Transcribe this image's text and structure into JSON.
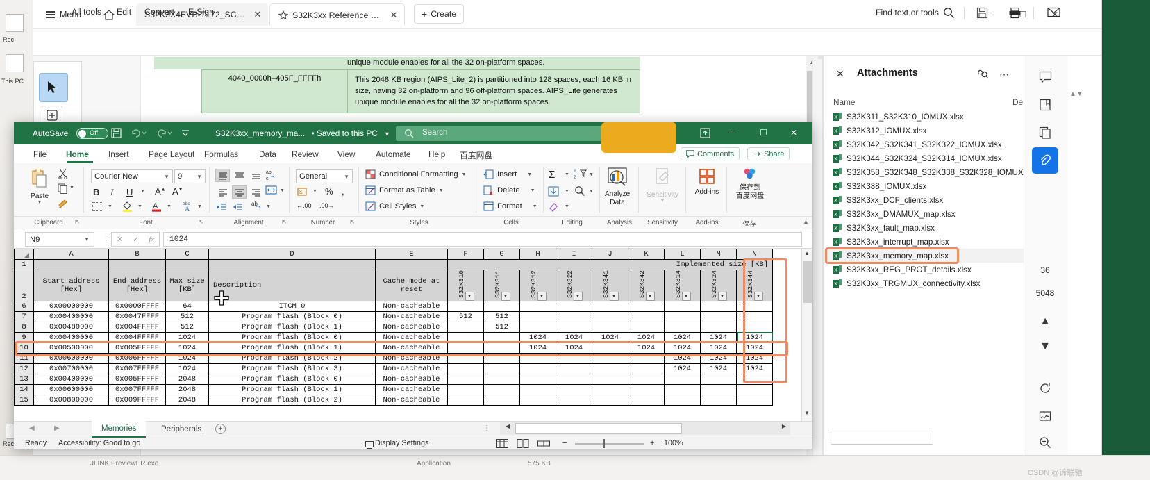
{
  "acrobat": {
    "menu_label": "Menu",
    "icons": {
      "hamburger": "hamburger-icon",
      "home": "home-icon",
      "star": "star-icon",
      "plus": "plus-icon"
    },
    "tabs": [
      {
        "title": "S32K3X4EVB-T172_SCH.pdf",
        "close": "✕"
      },
      {
        "title": "S32K3xx Reference Ma..",
        "close": "✕"
      }
    ],
    "create_label": "Create",
    "window_controls": {
      "minimize": "─",
      "maximize": "☐",
      "close": "✕"
    },
    "toolbar": {
      "all_tools": "All tools",
      "edit": "Edit",
      "convert": "Convert",
      "esign": "E-Sign",
      "find_label": "Find text or tools"
    },
    "page_text": {
      "top_line": "unique module enables for all the 32 on-platform spaces.",
      "range": "4040_0000h–405F_FFFFh",
      "body": "This 2048 KB region (AIPS_Lite_2) is partitioned into 128 spaces, each 16 KB in size, having 32 on-platform and 96 off-platform spaces. AIPS_Lite generates unique module enables for all the 32 on-platform spaces."
    },
    "attachments": {
      "title": "Attachments",
      "col_name": "Name",
      "col_desc": "De",
      "items": [
        "S32K311_S32K310_IOMUX.xlsx",
        "S32K312_IOMUX.xlsx",
        "S32K342_S32K341_S32K322_IOMUX.xlsx",
        "S32K344_S32K324_S32K314_IOMUX.xlsx",
        "S32K358_S32K348_S32K338_S32K328_IOMUX.xlsx",
        "S32K388_IOMUX.xlsx",
        "S32K3xx_DCF_clients.xlsx",
        "S32K3xx_DMAMUX_map.xlsx",
        "S32K3xx_fault_map.xlsx",
        "S32K3xx_interrupt_map.xlsx",
        "S32K3xx_memory_map.xlsx",
        "S32K3xx_REG_PROT_details.xlsx",
        "S32K3xx_TRGMUX_connectivity.xlsx"
      ],
      "selected_item": "S32K3xx_memory_map.xlsx"
    },
    "right_rail_values": {
      "page_count": "36",
      "total": "5048"
    }
  },
  "excel": {
    "autosave_label": "AutoSave",
    "autosave_state": "Off",
    "doc_name": "S32K3xx_memory_ma...",
    "save_state": "• Saved to this PC",
    "search_placeholder": "Search",
    "window_controls": {
      "ribbon_display": "⬆",
      "minimize": "─",
      "maximize": "☐",
      "close": "✕"
    },
    "ribbon_tabs": [
      "File",
      "Home",
      "Insert",
      "Page Layout",
      "Formulas",
      "Data",
      "Review",
      "View",
      "Automate",
      "Help",
      "百度网盘"
    ],
    "active_tab": "Home",
    "comments_label": "Comments",
    "share_label": "Share",
    "ribbon": {
      "paste_label": "Paste",
      "font_name": "Courier New",
      "font_size": "9",
      "number_format": "General",
      "styles": [
        "Conditional Formatting",
        "Format as Table",
        "Cell Styles"
      ],
      "cells": [
        "Insert",
        "Delete",
        "Format"
      ],
      "analyze_data": "Analyze Data",
      "sensitivity": "Sensitivity",
      "addins": "Add-ins",
      "baidu": "保存到\n百度网盘",
      "baidu_line1": "保存到",
      "baidu_line2": "百度网盘",
      "groups": [
        "Clipboard",
        "Font",
        "Alignment",
        "Number",
        "Styles",
        "Cells",
        "Editing",
        "Analysis",
        "Sensitivity",
        "Add-ins",
        "保存"
      ]
    },
    "formula_bar": {
      "name_box": "N9",
      "value": "1024",
      "fx_label": "fx",
      "cancel": "✕",
      "confirm": "✓"
    },
    "sheet": {
      "column_letters": [
        "A",
        "B",
        "C",
        "D",
        "E",
        "F",
        "G",
        "H",
        "I",
        "J",
        "K",
        "L",
        "M",
        "N"
      ],
      "banner": "Implemented size [KB]",
      "headers": [
        "Start address [Hex]",
        "End address [Hex]",
        "Max size [KB]",
        "Description",
        "Cache mode at reset"
      ],
      "header_lines": {
        "a": [
          "Start address",
          "[Hex]"
        ],
        "b": [
          "End address",
          "[Hex]"
        ],
        "c": [
          "Max size",
          "[KB]"
        ],
        "d": [
          "Description"
        ],
        "e": [
          "Cache mode at",
          "reset"
        ]
      },
      "device_columns": [
        "S32K310",
        "S32K311",
        "S32K312",
        "S32K322",
        "S32K341",
        "S32K342",
        "S32K314",
        "S32K324",
        "S32K344"
      ],
      "rows": [
        {
          "num": "6",
          "start": "0x00000000",
          "end": "0x0000FFFF",
          "max": "64",
          "desc": "ITCM_0",
          "cache": "Non-cacheable",
          "sizes": [
            "",
            "",
            "",
            "",
            "",
            "",
            "",
            "",
            ""
          ]
        },
        {
          "num": "7",
          "start": "0x00400000",
          "end": "0x0047FFFF",
          "max": "512",
          "desc": "Program flash (Block 0)",
          "cache": "Non-cacheable",
          "sizes": [
            "512",
            "512",
            "",
            "",
            "",
            "",
            "",
            "",
            ""
          ]
        },
        {
          "num": "8",
          "start": "0x00480000",
          "end": "0x004FFFFF",
          "max": "512",
          "desc": "Program flash (Block 1)",
          "cache": "Non-cacheable",
          "sizes": [
            "",
            "512",
            "",
            "",
            "",
            "",
            "",
            "",
            ""
          ]
        },
        {
          "num": "9",
          "start": "0x00400000",
          "end": "0x004FFFFF",
          "max": "1024",
          "desc": "Program flash (Block 0)",
          "cache": "Non-cacheable",
          "sizes": [
            "",
            "",
            "1024",
            "1024",
            "1024",
            "1024",
            "1024",
            "1024",
            "1024"
          ]
        },
        {
          "num": "10",
          "start": "0x00500000",
          "end": "0x005FFFFF",
          "max": "1024",
          "desc": "Program flash (Block 1)",
          "cache": "Non-cacheable",
          "sizes": [
            "",
            "",
            "1024",
            "1024",
            "",
            "1024",
            "1024",
            "1024",
            "1024"
          ]
        },
        {
          "num": "11",
          "start": "0x00600000",
          "end": "0x006FFFFF",
          "max": "1024",
          "desc": "Program flash (Block 2)",
          "cache": "Non-cacheable",
          "sizes": [
            "",
            "",
            "",
            "",
            "",
            "",
            "1024",
            "1024",
            "1024"
          ]
        },
        {
          "num": "12",
          "start": "0x00700000",
          "end": "0x007FFFFF",
          "max": "1024",
          "desc": "Program flash (Block 3)",
          "cache": "Non-cacheable",
          "sizes": [
            "",
            "",
            "",
            "",
            "",
            "",
            "1024",
            "1024",
            "1024"
          ]
        },
        {
          "num": "13",
          "start": "0x00400000",
          "end": "0x005FFFFF",
          "max": "2048",
          "desc": "Program flash (Block 0)",
          "cache": "Non-cacheable",
          "sizes": [
            "",
            "",
            "",
            "",
            "",
            "",
            "",
            "",
            ""
          ]
        },
        {
          "num": "14",
          "start": "0x00600000",
          "end": "0x007FFFFF",
          "max": "2048",
          "desc": "Program flash (Block 1)",
          "cache": "Non-cacheable",
          "sizes": [
            "",
            "",
            "",
            "",
            "",
            "",
            "",
            "",
            ""
          ]
        },
        {
          "num": "15",
          "start": "0x00800000",
          "end": "0x009FFFFF",
          "max": "2048",
          "desc": "Program flash (Block 2)",
          "cache": "Non-cacheable",
          "sizes": [
            "",
            "",
            "",
            "",
            "",
            "",
            "",
            "",
            ""
          ]
        }
      ],
      "selected_cell": "N9",
      "selected_value": "1024"
    },
    "sheet_tabs": [
      "Memories",
      "Peripherals"
    ],
    "active_sheet": "Memories",
    "status": {
      "ready": "Ready",
      "accessibility": "Accessibility: Good to go",
      "display_settings": "Display Settings",
      "zoom": "100%",
      "zoom_minus": "−",
      "zoom_plus": "+"
    }
  },
  "desktop": {
    "labels": [
      "This PC",
      "Rec"
    ],
    "watermark": "CSDN @谛联驰"
  },
  "colors": {
    "excel_green": "#217346",
    "highlight_orange": "#ef8b63",
    "redaction_yellow": "#ecab1e",
    "accent_blue": "#1473e6",
    "pdf_green": "#cfe8cf"
  }
}
